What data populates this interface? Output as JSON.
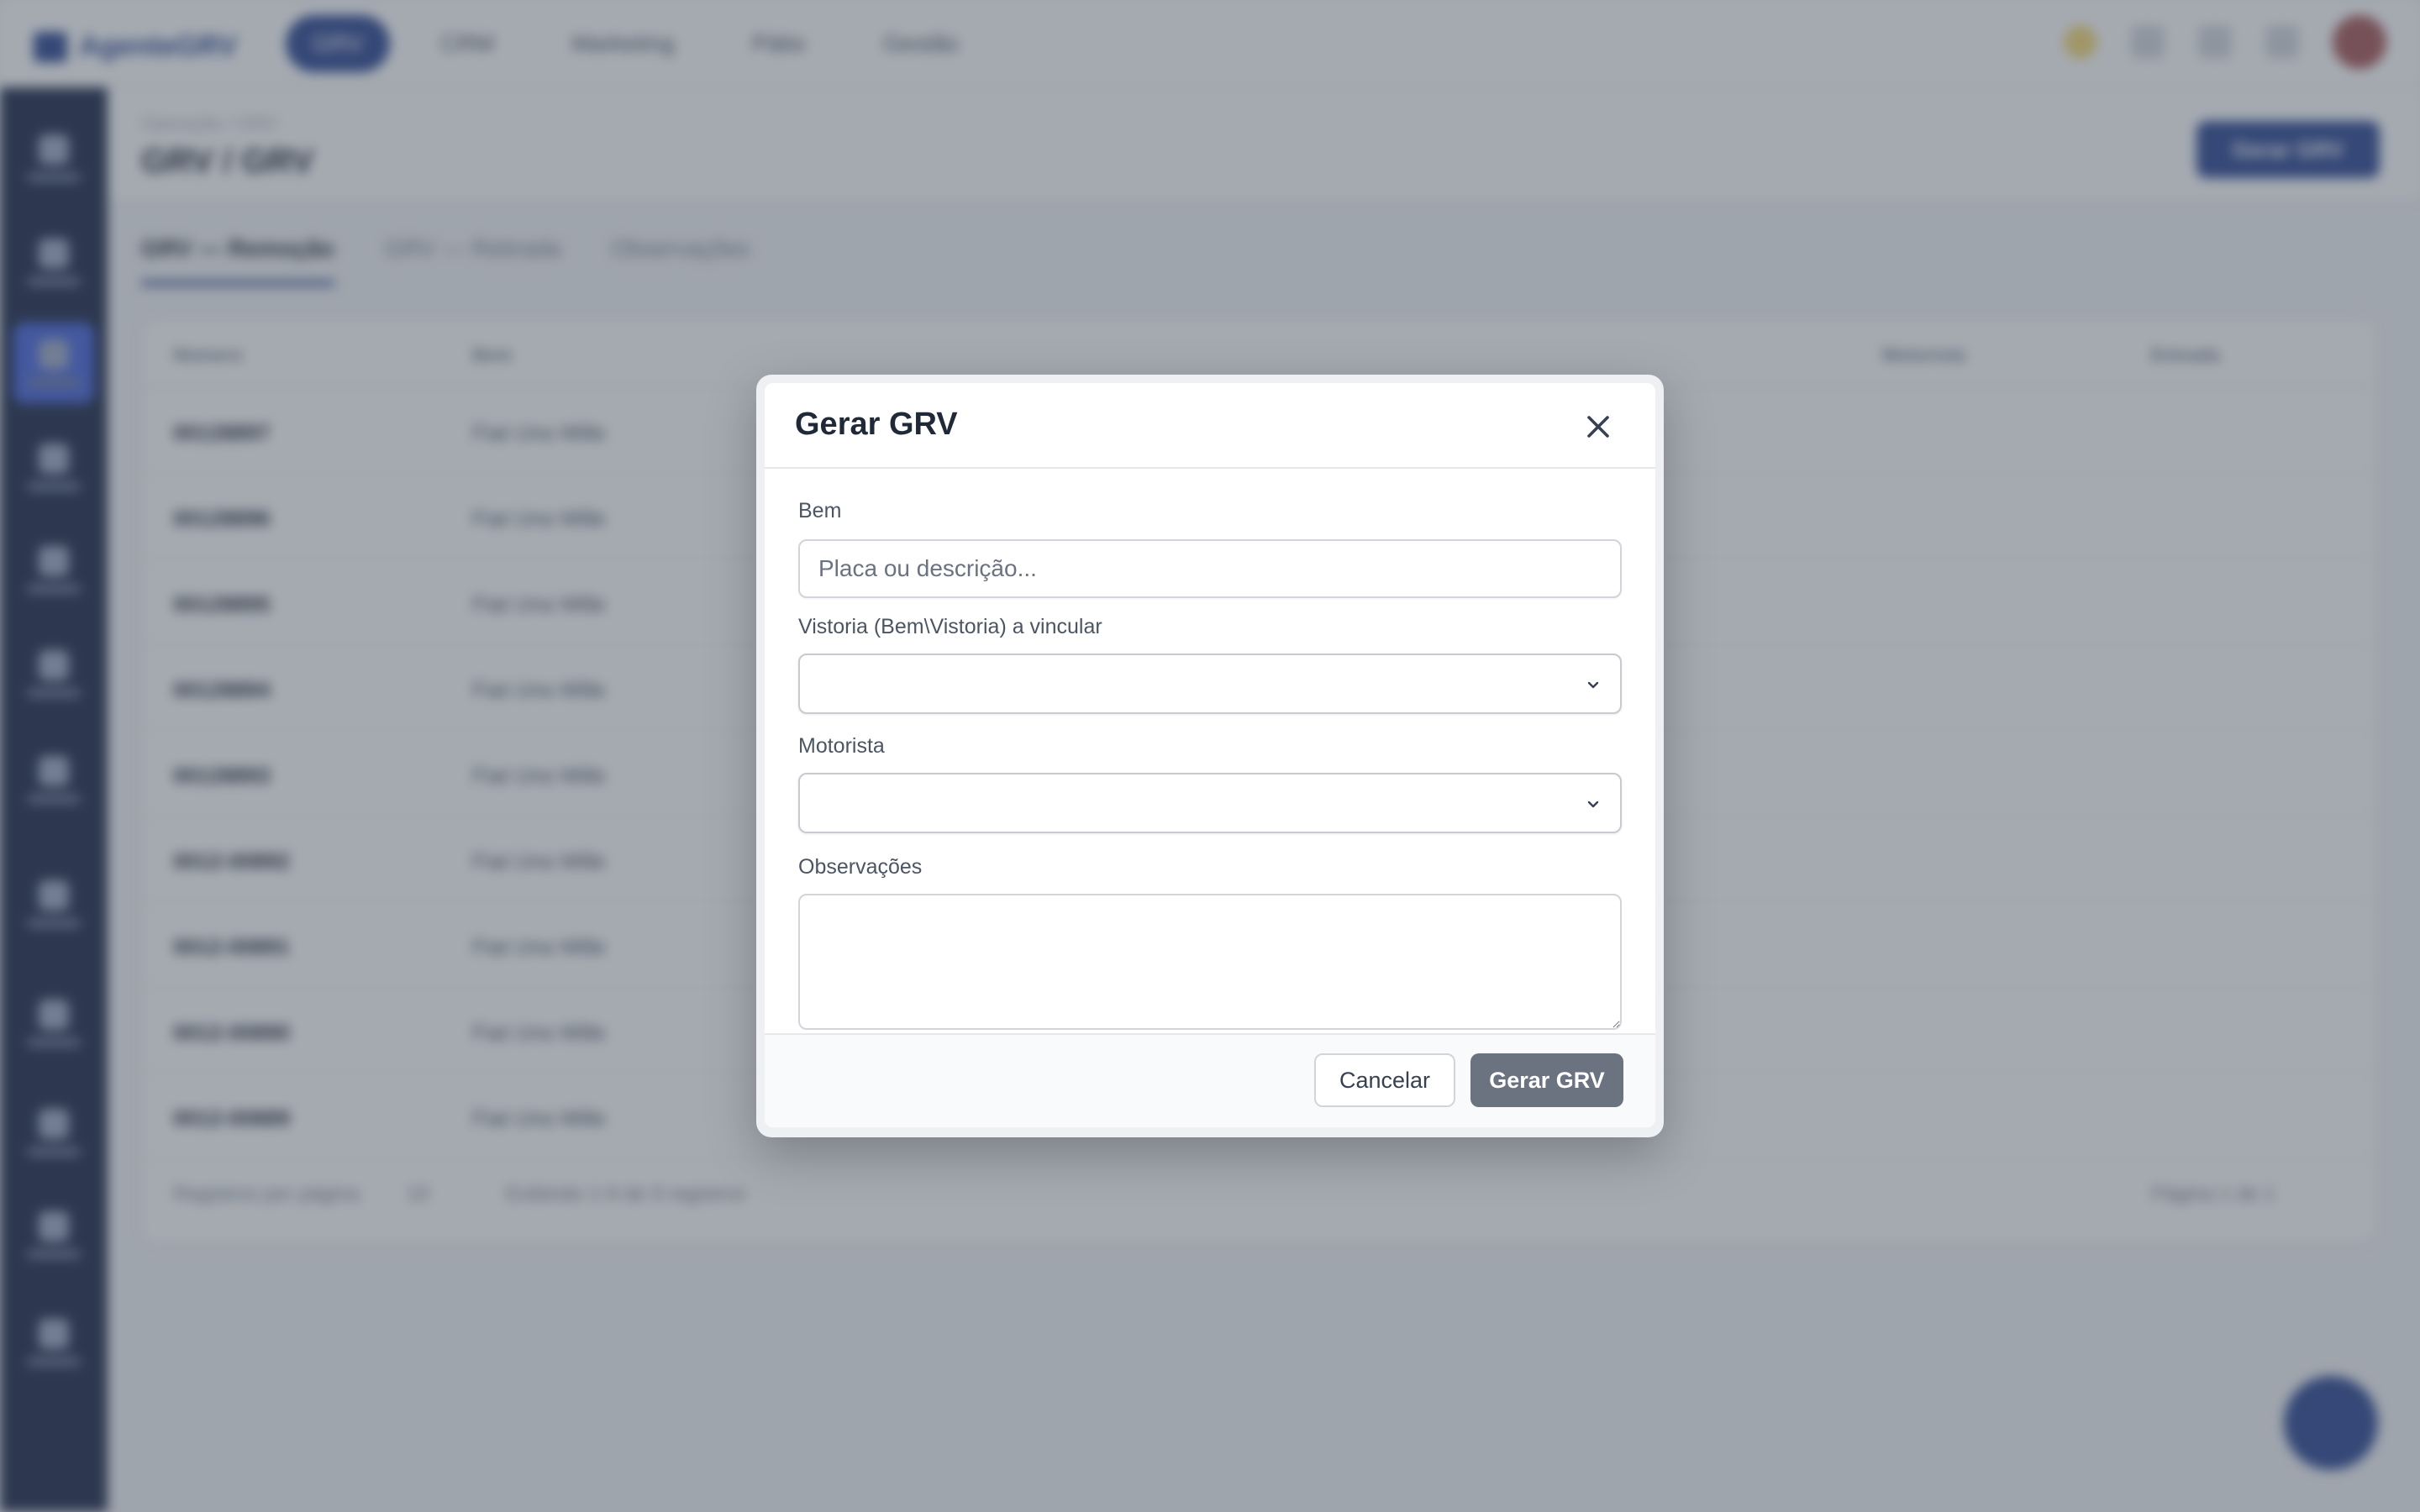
{
  "app": {
    "brand": "AgenteGRV"
  },
  "topnav": {
    "items": [
      "GRV",
      "CRM",
      "Marketing",
      "Pátio",
      "Gestão"
    ]
  },
  "page": {
    "breadcrumb": "Operação / GRV",
    "title": "GRV / GRV",
    "action_label": "Gerar GRV"
  },
  "tabs": [
    "GRV — Remoção",
    "GRV — Retirada",
    "Observações"
  ],
  "table": {
    "columns": [
      "Número",
      "Bem",
      "Motorista",
      "Entrada"
    ],
    "rows": [
      [
        "00128897",
        "Fiat Uno Mille"
      ],
      [
        "00128896",
        "Fiat Uno Mille"
      ],
      [
        "00128895",
        "Fiat Uno Mille"
      ],
      [
        "00128894",
        "Fiat Uno Mille"
      ],
      [
        "00128893",
        "Fiat Uno Mille"
      ],
      [
        "0012-00892",
        "Fiat Uno Mille"
      ],
      [
        "0012-00891",
        "Fiat Uno Mille"
      ],
      [
        "0012-00890",
        "Fiat Uno Mille"
      ],
      [
        "0012-00889",
        "Fiat Uno Mille"
      ]
    ],
    "footer_left": "Registros por página",
    "footer_page_size": "10",
    "footer_range": "Exibindo 1-9 de 9 registros",
    "footer_right": "Página 1 de 1"
  },
  "modal": {
    "title": "Gerar GRV",
    "bem": {
      "label": "Bem",
      "placeholder": "Placa ou descrição...",
      "value": ""
    },
    "vistoria": {
      "label": "Vistoria (Bem\\Vistoria) a vincular",
      "value": ""
    },
    "motorista": {
      "label": "Motorista",
      "value": ""
    },
    "observacoes": {
      "label": "Observações",
      "value": ""
    },
    "cancel_label": "Cancelar",
    "submit_label": "Gerar GRV"
  },
  "colors": {
    "primary": "#1e3a8a",
    "sidebar": "#0f1b3d",
    "submit_disabled": "#6b7280",
    "overlay": "#4b5563"
  },
  "icons": {
    "close": "close-icon",
    "select_arrow": "chevron-down-icon"
  }
}
